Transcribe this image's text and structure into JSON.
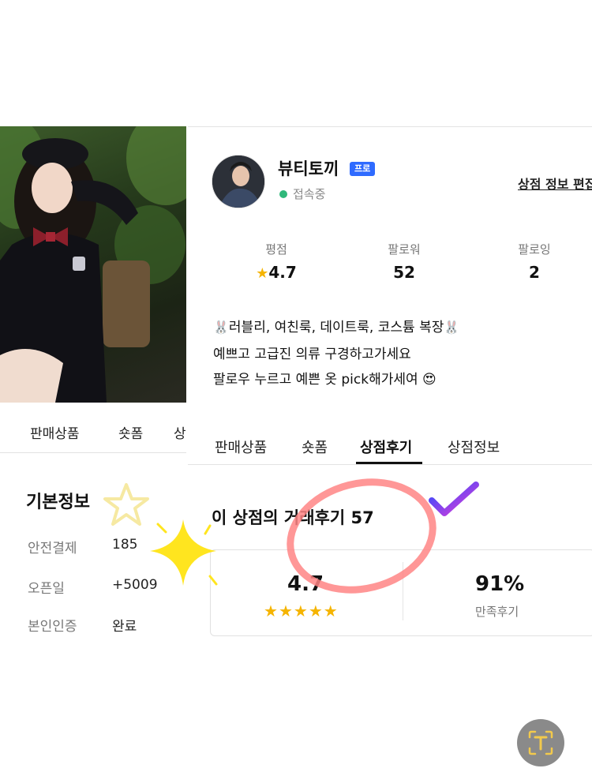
{
  "left": {
    "tabs": [
      "판매상품",
      "숏폼",
      "상"
    ],
    "basic_info": {
      "title": "기본정보",
      "rows": [
        {
          "label": "안전결제",
          "value": "185"
        },
        {
          "label": "오픈일",
          "value": "+5009"
        },
        {
          "label": "본인인증",
          "value": "완료"
        }
      ]
    }
  },
  "shop": {
    "name": "뷰티토끼",
    "badge": "프로",
    "status": "접속중",
    "edit_label": "상점 정보 편집",
    "stats": [
      {
        "label": "평점",
        "value": "4.7"
      },
      {
        "label": "팔로워",
        "value": "52"
      },
      {
        "label": "팔로잉",
        "value": "2"
      }
    ],
    "bio": [
      "러블리, 여친룩, 데이트룩, 코스튬 복장",
      "예쁘고 고급진 의류 구경하고가세요",
      "팔로우 누르고 예쁜 옷 pick해가세여"
    ]
  },
  "tabs": [
    "판매상품",
    "숏폼",
    "상점후기",
    "상점정보"
  ],
  "active_tab": "상점후기",
  "reviews": {
    "heading": "이 상점의 거래후기 57",
    "score": "4.7",
    "stars": 5,
    "satisfaction": "91%",
    "satisfaction_label": "만족후기"
  },
  "icons": {
    "star": "star-icon",
    "rabbit": "rabbit-emoji",
    "heart_eyes": "heart-eyes-emoji",
    "check": "check-mark-icon",
    "ocr": "text-scan-icon"
  },
  "colors": {
    "accent_blue": "#2f6bff",
    "online_green": "#2fb87a",
    "star_yellow": "#f5b400",
    "annotation_red": "#ff8585"
  }
}
